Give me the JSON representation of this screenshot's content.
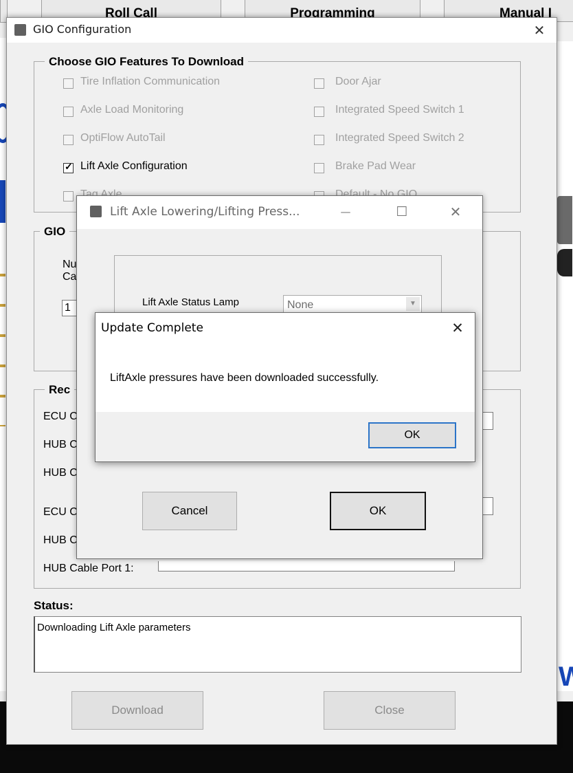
{
  "background": {
    "tabs": [
      "Roll Call",
      "Programming",
      "Manual I"
    ],
    "edge_letters": [
      "F",
      "W"
    ]
  },
  "main_window": {
    "title": "GIO Configuration",
    "close_glyph": "✕",
    "features": {
      "legend": "Choose GIO Features To Download",
      "left": [
        {
          "label": "Tire Inflation Communication",
          "checked": false,
          "enabled": false
        },
        {
          "label": "Axle Load Monitoring",
          "checked": false,
          "enabled": false
        },
        {
          "label": "OptiFlow AutoTail",
          "checked": false,
          "enabled": false
        },
        {
          "label": "Lift Axle Configuration",
          "checked": true,
          "enabled": true
        },
        {
          "label": "Tag Axle",
          "checked": false,
          "enabled": false
        }
      ],
      "right": [
        {
          "label": "Door Ajar",
          "checked": false,
          "enabled": false
        },
        {
          "label": "Integrated Speed Switch 1",
          "checked": false,
          "enabled": false
        },
        {
          "label": "Integrated Speed Switch 2",
          "checked": false,
          "enabled": false
        },
        {
          "label": "Brake Pad Wear",
          "checked": false,
          "enabled": false
        },
        {
          "label": "Default - No GIO",
          "checked": false,
          "enabled": false
        }
      ]
    },
    "gio_group": {
      "legend": "GIO",
      "label_line1": "Nu",
      "label_line2": "Ca",
      "value": "1"
    },
    "rec_group": {
      "legend": "Rec",
      "rows": [
        "ECU C",
        "HUB C",
        "HUB C",
        "ECU C",
        "HUB C",
        "HUB Cable Port 1:"
      ]
    },
    "status": {
      "label": "Status:",
      "text": "Downloading Lift Axle parameters"
    },
    "buttons": {
      "download": "Download",
      "close": "Close"
    }
  },
  "lift_dialog": {
    "title": "Lift Axle Lowering/Lifting Press...",
    "minimize_glyph": "—",
    "maximize_glyph": "☐",
    "close_glyph": "✕",
    "lamp_label": "Lift Axle Status Lamp",
    "lamp_value": "None",
    "cancel_label": "Cancel",
    "ok_label": "OK"
  },
  "message_box": {
    "title": "Update Complete",
    "close_glyph": "✕",
    "message": "LiftAxle pressures have been downloaded successfully.",
    "ok_label": "OK"
  }
}
